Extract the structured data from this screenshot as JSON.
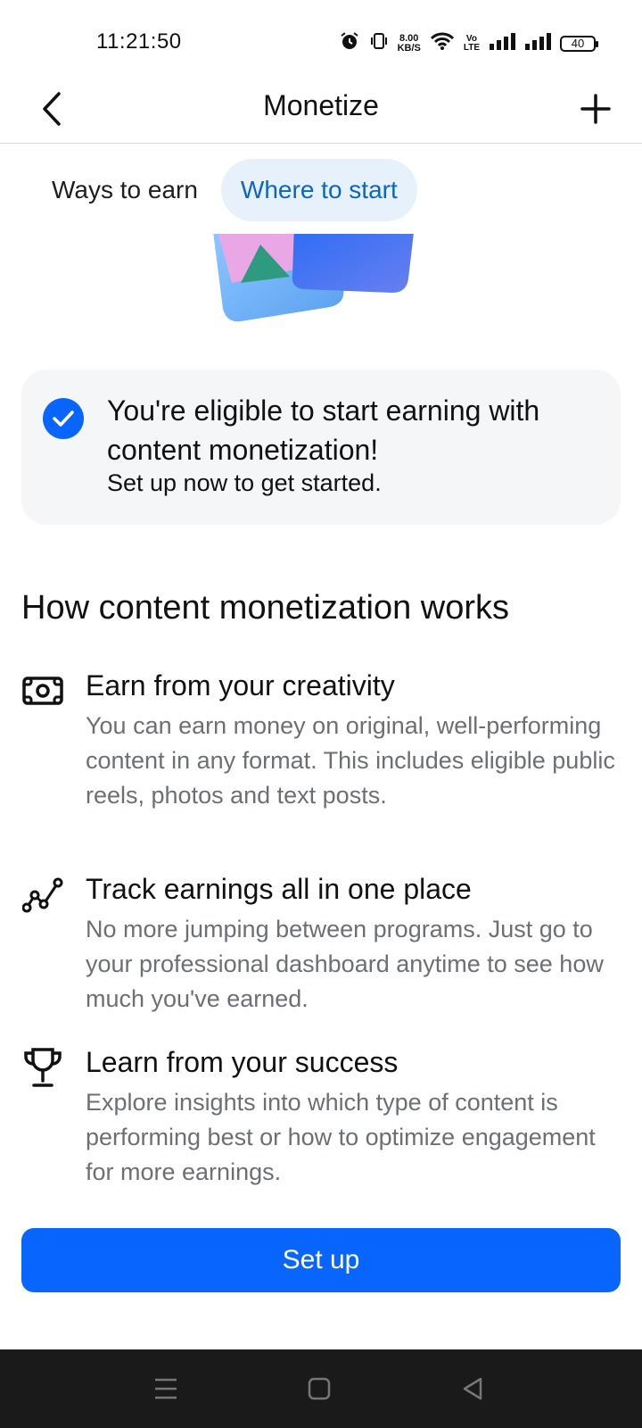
{
  "status_bar": {
    "time": "11:21:50",
    "net_speed_value": "8.00",
    "net_speed_unit": "KB/S",
    "volte_top": "Vo",
    "volte_bottom": "LTE",
    "battery": "40"
  },
  "header": {
    "title": "Monetize",
    "back_icon": "back-arrow-icon",
    "add_icon": "plus-icon"
  },
  "tabs": [
    {
      "label": "Ways to earn",
      "active": false
    },
    {
      "label": "Where to start",
      "active": true
    }
  ],
  "eligibility_card": {
    "title": "You're eligible to start earning with content monetization!",
    "subtitle": "Set up now to get started.",
    "icon": "checkmark-circle-icon",
    "accent": "#0866ff"
  },
  "section": {
    "title": "How content monetization works",
    "features": [
      {
        "icon": "money-bill-icon",
        "title": "Earn from your creativity",
        "description": "You can earn money on original, well-performing content in any format. This includes eligible public reels, photos and text posts."
      },
      {
        "icon": "trend-line-icon",
        "title": "Track earnings all in one place",
        "description": "No more jumping between programs. Just go to your professional dashboard anytime to see how much you've earned."
      },
      {
        "icon": "trophy-icon",
        "title": "Learn from your success",
        "description": "Explore insights into which type of content is performing best or how to optimize engagement for more earnings."
      }
    ]
  },
  "primary_button": {
    "label": "Set up",
    "color": "#0866ff"
  },
  "nav_bar": {
    "menu_icon": "menu-icon",
    "home_icon": "home-square-icon",
    "back_icon": "nav-back-triangle-icon"
  }
}
